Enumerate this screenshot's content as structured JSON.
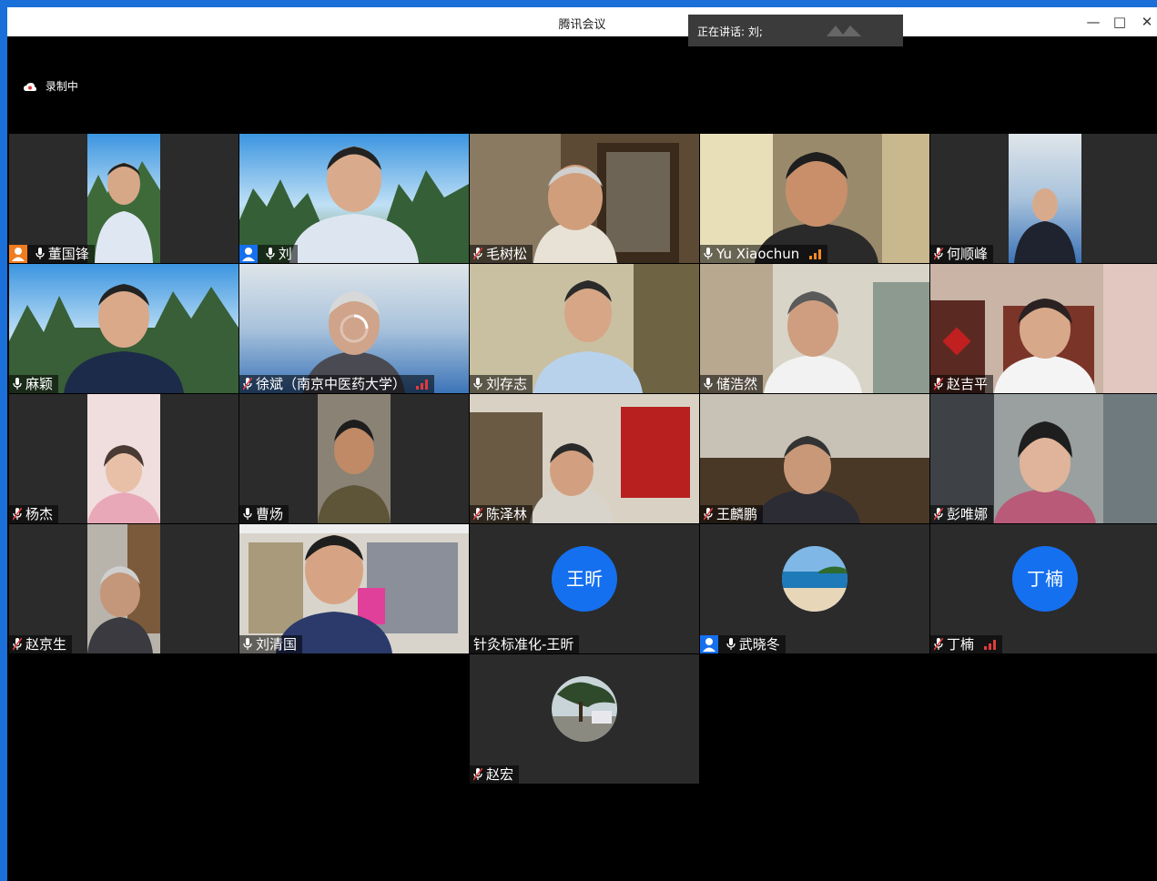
{
  "window": {
    "title": "腾讯会议"
  },
  "speaking": {
    "text": "正在讲话: 刘;"
  },
  "recording": {
    "label": "录制中"
  },
  "participants": [
    {
      "name": "董国锋"
    },
    {
      "name": "刘"
    },
    {
      "name": "毛树松"
    },
    {
      "name": "Yu Xiaochun"
    },
    {
      "name": "何顺峰"
    },
    {
      "name": "麻颖"
    },
    {
      "name": "徐斌（南京中医药大学）"
    },
    {
      "name": "刘存志"
    },
    {
      "name": "储浩然"
    },
    {
      "name": "赵吉平"
    },
    {
      "name": "杨杰"
    },
    {
      "name": "曹炀"
    },
    {
      "name": "陈泽林"
    },
    {
      "name": "王麟鹏"
    },
    {
      "name": "彭唯娜"
    },
    {
      "name": "赵京生"
    },
    {
      "name": "刘清国"
    },
    {
      "name": "针灸标准化-王昕",
      "avatar_text": "王昕"
    },
    {
      "name": "武晓冬"
    },
    {
      "name": "丁楠",
      "avatar_text": "丁楠"
    },
    {
      "name": "赵宏"
    }
  ],
  "colors": {
    "avatar_blue": "#1570ef",
    "tile_bg": "#2b2b2b",
    "host_badge": "#f07c1e"
  }
}
